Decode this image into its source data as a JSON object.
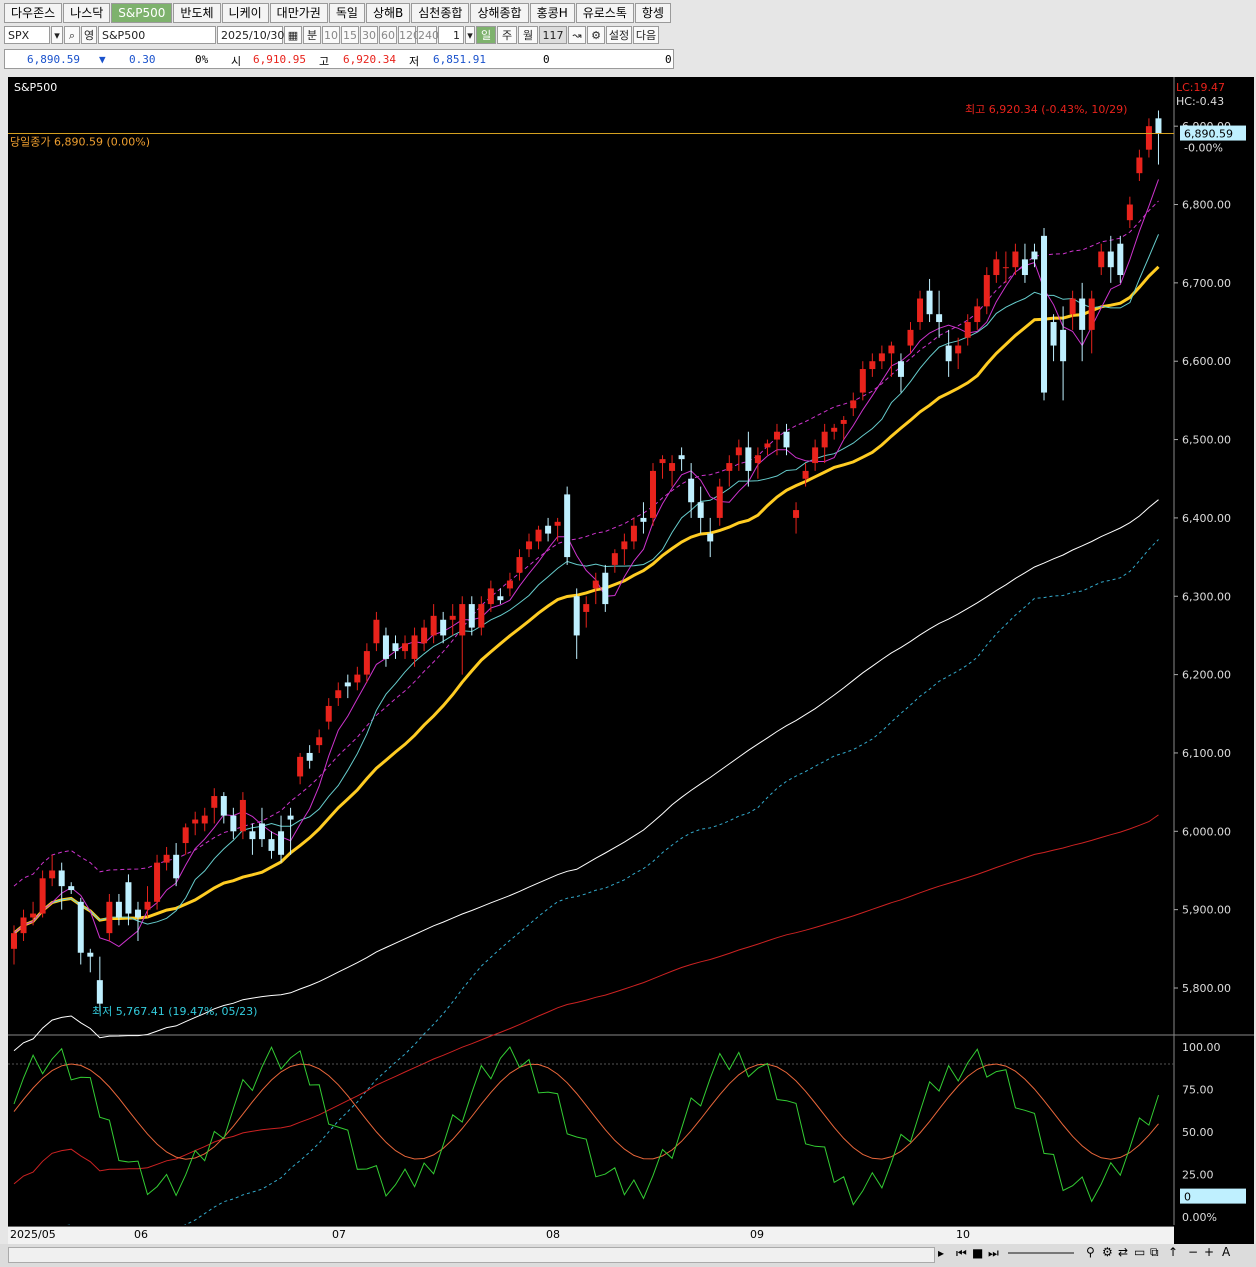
{
  "tabs": [
    "다우존스",
    "나스닥",
    "S&P500",
    "반도체",
    "니케이",
    "대만가권",
    "독일",
    "상해B",
    "심천종합",
    "상해종합",
    "홍콩H",
    "유로스톡",
    "항셍"
  ],
  "active_tab": "S&P500",
  "toolbar": {
    "symbol": "SPX",
    "symbol_suffix": "영",
    "name": "S&P500",
    "date": "2025/10/30",
    "period_unit": "분",
    "periods": [
      "10",
      "15",
      "30",
      "60",
      "120",
      "240"
    ],
    "period_value": "1",
    "day": "일",
    "week": "주",
    "month": "월",
    "count": "117",
    "settings": "설정",
    "next": "다음"
  },
  "quote": {
    "price": "6,890.59",
    "arrow": "▼",
    "change": "0.30",
    "pct": "0%",
    "open_label": "시",
    "open": "6,910.95",
    "high_label": "고",
    "high": "6,920.34",
    "low_label": "저",
    "low": "6,851.91",
    "v1": "0",
    "v2": "0"
  },
  "chart": {
    "title": "S&P500",
    "close_label": "당일종가 6,890.59 (0.00%)",
    "high_annot": "최고 6,920.34 (-0.43%, 10/29)",
    "low_annot": "최저 5,767.41 (19.47%, 05/23)",
    "lc": "LC:19.47",
    "hc": "HC:-0.43",
    "price_tag": "6,890.59",
    "pct_tag": "-0.00%",
    "y_ticks": [
      "6,900.00",
      "6,800.00",
      "6,700.00",
      "6,600.00",
      "6,500.00",
      "6,400.00",
      "6,300.00",
      "6,200.00",
      "6,100.00",
      "6,000.00",
      "5,900.00",
      "5,800.00"
    ],
    "osc_ticks": [
      "100.00",
      "75.00",
      "50.00",
      "25.00",
      "0.00%"
    ],
    "osc_tag": "0",
    "x_labels": [
      "2025/05",
      "06",
      "07",
      "08",
      "09",
      "10"
    ],
    "last_date": "10/29",
    "colors": {
      "up": "#e8231c",
      "down": "#bff0ff",
      "ma5": "#cc33cc",
      "ma10": "#66cccc",
      "ma20": "#ffcc22",
      "ma60": "#ffffff",
      "ma120": "#cc2222",
      "bb": "#cc33cc",
      "osc_k": "#33cc33",
      "osc_d": "#e8663a",
      "fill": "#ffbf8c"
    }
  },
  "chart_data": {
    "type": "candlestick",
    "ylim": [
      5740,
      6950
    ],
    "candles": [
      [
        5850,
        5880,
        5830,
        5870
      ],
      [
        5870,
        5900,
        5860,
        5890
      ],
      [
        5890,
        5910,
        5880,
        5895
      ],
      [
        5895,
        5950,
        5890,
        5940
      ],
      [
        5940,
        5970,
        5930,
        5950
      ],
      [
        5950,
        5960,
        5900,
        5930
      ],
      [
        5930,
        5935,
        5920,
        5925
      ],
      [
        5910,
        5915,
        5830,
        5845
      ],
      [
        5845,
        5850,
        5820,
        5840
      ],
      [
        5810,
        5840,
        5770,
        5780
      ],
      [
        5870,
        5920,
        5860,
        5910
      ],
      [
        5910,
        5920,
        5880,
        5890
      ],
      [
        5935,
        5945,
        5880,
        5895
      ],
      [
        5900,
        5910,
        5860,
        5890
      ],
      [
        5900,
        5930,
        5890,
        5910
      ],
      [
        5910,
        5970,
        5900,
        5960
      ],
      [
        5960,
        5980,
        5950,
        5970
      ],
      [
        5970,
        5985,
        5930,
        5940
      ],
      [
        5985,
        6010,
        5970,
        6005
      ],
      [
        6010,
        6025,
        5995,
        6015
      ],
      [
        6010,
        6030,
        6000,
        6020
      ],
      [
        6030,
        6055,
        6010,
        6045
      ],
      [
        6045,
        6050,
        6010,
        6020
      ],
      [
        6020,
        6030,
        5990,
        6000
      ],
      [
        6000,
        6050,
        5990,
        6040
      ],
      [
        6000,
        6010,
        5970,
        5990
      ],
      [
        6010,
        6030,
        5980,
        5990
      ],
      [
        5990,
        6000,
        5965,
        5975
      ],
      [
        6000,
        6020,
        5960,
        5970
      ],
      [
        6020,
        6030,
        5970,
        6015
      ],
      [
        6070,
        6100,
        6060,
        6095
      ],
      [
        6100,
        6110,
        6080,
        6090
      ],
      [
        6110,
        6130,
        6100,
        6120
      ],
      [
        6140,
        6170,
        6130,
        6160
      ],
      [
        6170,
        6190,
        6160,
        6180
      ],
      [
        6190,
        6200,
        6170,
        6185
      ],
      [
        6190,
        6210,
        6180,
        6200
      ],
      [
        6200,
        6240,
        6190,
        6230
      ],
      [
        6240,
        6280,
        6230,
        6270
      ],
      [
        6250,
        6260,
        6210,
        6220
      ],
      [
        6240,
        6250,
        6220,
        6230
      ],
      [
        6230,
        6250,
        6220,
        6240
      ],
      [
        6220,
        6260,
        6210,
        6250
      ],
      [
        6240,
        6270,
        6230,
        6260
      ],
      [
        6250,
        6290,
        6240,
        6275
      ],
      [
        6270,
        6280,
        6240,
        6250
      ],
      [
        6270,
        6290,
        6250,
        6275
      ],
      [
        6250,
        6300,
        6200,
        6290
      ],
      [
        6290,
        6300,
        6250,
        6260
      ],
      [
        6260,
        6300,
        6250,
        6290
      ],
      [
        6290,
        6320,
        6280,
        6310
      ],
      [
        6300,
        6310,
        6290,
        6295
      ],
      [
        6310,
        6330,
        6300,
        6320
      ],
      [
        6330,
        6360,
        6320,
        6350
      ],
      [
        6360,
        6380,
        6350,
        6370
      ],
      [
        6370,
        6390,
        6360,
        6385
      ],
      [
        6390,
        6400,
        6370,
        6380
      ],
      [
        6390,
        6400,
        6370,
        6395
      ],
      [
        6430,
        6440,
        6340,
        6350
      ],
      [
        6300,
        6310,
        6220,
        6250
      ],
      [
        6280,
        6300,
        6260,
        6290
      ],
      [
        6310,
        6330,
        6290,
        6320
      ],
      [
        6330,
        6340,
        6280,
        6290
      ],
      [
        6340,
        6360,
        6330,
        6355
      ],
      [
        6360,
        6380,
        6340,
        6370
      ],
      [
        6370,
        6400,
        6360,
        6390
      ],
      [
        6400,
        6420,
        6380,
        6395
      ],
      [
        6400,
        6470,
        6390,
        6460
      ],
      [
        6470,
        6480,
        6450,
        6475
      ],
      [
        6460,
        6480,
        6440,
        6470
      ],
      [
        6480,
        6490,
        6460,
        6475
      ],
      [
        6450,
        6470,
        6400,
        6420
      ],
      [
        6420,
        6440,
        6380,
        6400
      ],
      [
        6380,
        6400,
        6350,
        6370
      ],
      [
        6400,
        6450,
        6390,
        6440
      ],
      [
        6460,
        6480,
        6440,
        6470
      ],
      [
        6480,
        6500,
        6460,
        6490
      ],
      [
        6490,
        6510,
        6440,
        6460
      ],
      [
        6470,
        6490,
        6450,
        6480
      ],
      [
        6490,
        6500,
        6480,
        6495
      ],
      [
        6500,
        6520,
        6480,
        6510
      ],
      [
        6510,
        6520,
        6480,
        6490
      ],
      [
        6400,
        6420,
        6380,
        6410
      ],
      [
        6450,
        6470,
        6440,
        6460
      ],
      [
        6470,
        6500,
        6460,
        6490
      ],
      [
        6490,
        6520,
        6470,
        6510
      ],
      [
        6510,
        6520,
        6500,
        6515
      ],
      [
        6520,
        6530,
        6500,
        6525
      ],
      [
        6540,
        6560,
        6530,
        6550
      ],
      [
        6560,
        6600,
        6550,
        6590
      ],
      [
        6590,
        6610,
        6580,
        6600
      ],
      [
        6600,
        6620,
        6590,
        6610
      ],
      [
        6610,
        6625,
        6580,
        6620
      ],
      [
        6600,
        6610,
        6560,
        6580
      ],
      [
        6620,
        6650,
        6610,
        6640
      ],
      [
        6650,
        6690,
        6640,
        6680
      ],
      [
        6690,
        6705,
        6650,
        6660
      ],
      [
        6660,
        6690,
        6630,
        6650
      ],
      [
        6620,
        6640,
        6580,
        6600
      ],
      [
        6610,
        6630,
        6590,
        6620
      ],
      [
        6630,
        6660,
        6620,
        6650
      ],
      [
        6650,
        6680,
        6640,
        6670
      ],
      [
        6670,
        6720,
        6660,
        6710
      ],
      [
        6710,
        6740,
        6700,
        6730
      ],
      [
        6720,
        6740,
        6700,
        6720
      ],
      [
        6720,
        6750,
        6710,
        6740
      ],
      [
        6730,
        6750,
        6700,
        6710
      ],
      [
        6740,
        6750,
        6720,
        6730
      ],
      [
        6760,
        6770,
        6550,
        6560
      ],
      [
        6650,
        6660,
        6600,
        6620
      ],
      [
        6640,
        6670,
        6550,
        6600
      ],
      [
        6660,
        6690,
        6640,
        6680
      ],
      [
        6680,
        6700,
        6600,
        6640
      ],
      [
        6640,
        6690,
        6610,
        6680
      ],
      [
        6720,
        6750,
        6710,
        6740
      ],
      [
        6740,
        6760,
        6700,
        6720
      ],
      [
        6750,
        6760,
        6700,
        6710
      ],
      [
        6780,
        6810,
        6770,
        6800
      ],
      [
        6840,
        6870,
        6830,
        6860
      ],
      [
        6870,
        6910,
        6860,
        6900
      ],
      [
        6910,
        6920,
        6851,
        6890
      ]
    ],
    "oscillator": {
      "k": [],
      "d": []
    }
  }
}
